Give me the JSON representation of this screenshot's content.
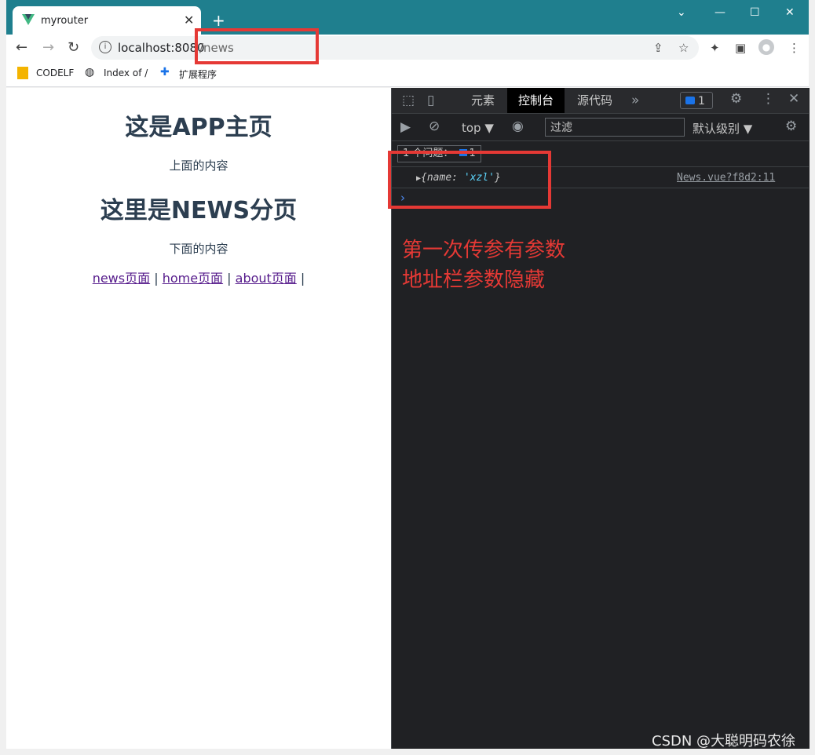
{
  "browser": {
    "tab_title": "myrouter",
    "url_host": "localhost:8080",
    "url_path": "/news",
    "bookmarks": [
      {
        "label": "CODELF"
      },
      {
        "label": "Index of /"
      },
      {
        "label": "扩展程序"
      }
    ]
  },
  "page": {
    "title": "这是APP主页",
    "top_text": "上面的内容",
    "news_title": "这里是NEWS分页",
    "bottom_text": "下面的内容",
    "links": [
      "news页面",
      "home页面",
      "about页面"
    ],
    "separator": "|"
  },
  "devtools": {
    "tabs": [
      "元素",
      "控制台",
      "源代码"
    ],
    "issues_badge": "1",
    "context": "top",
    "filter_placeholder": "过滤",
    "level": "默认级别",
    "issue_summary": "1 个问题：",
    "issue_count": "1",
    "log_key": "name",
    "log_value": "'xzl'",
    "log_source": "News.vue?f8d2:11"
  },
  "annotation": {
    "line1": "第一次传参有参数",
    "line2": "地址栏参数隐藏"
  },
  "watermark": "CSDN @大聪明码农徐",
  "colors": {
    "titlebar": "#1f7f8e",
    "annotation": "#e53935",
    "devtools_bg": "#202124"
  }
}
